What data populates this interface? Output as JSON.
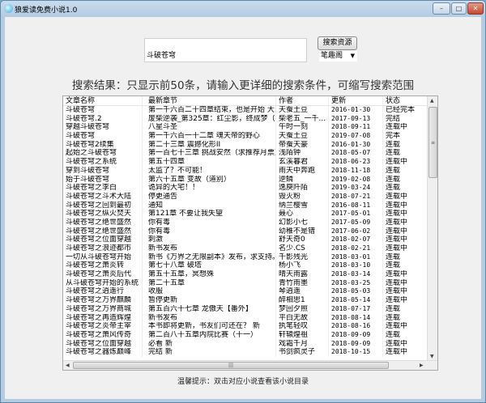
{
  "window": {
    "title": "狼爱读免费小说1.0",
    "minimize": "–",
    "maximize": "□",
    "close": "✕"
  },
  "search": {
    "value": "斗破苍穹",
    "button": "搜索资源",
    "source": "笔趣阁"
  },
  "heading": "搜索结果：只显示前50条，请输入更详细的搜索条件，可缩写搜索范围",
  "table": {
    "columns": [
      "文章名称",
      "最新章节",
      "作者",
      "更新",
      "状态"
    ],
    "rows": [
      [
        "斗破苍穹",
        "第一千六百二十四章结束，也是开始 大...",
        "天蚕土豆",
        "2016-01-30",
        "已经完本"
      ],
      [
        "斗破苍穹.2",
        "废柴逆袭_第325章：红尘影，终成梦（...",
        "柴老五_一千...",
        "2017-09-13",
        "完结"
      ],
      [
        "穿越斗破苍穹",
        "八星斗圣",
        "午时一刻",
        "2018-09-11",
        "连载中"
      ],
      [
        "斗破苍穹",
        "第一千六百一十二章 魂天帝的野心",
        "天蚕土豆",
        "2019-07-08",
        "完本"
      ],
      [
        "斗破苍穹2续集",
        "第二十三章 震撼化形II",
        "帝蚕天豪",
        "2016-01-30",
        "连载"
      ],
      [
        "起始之斗破苍穹",
        "第一百七十三章 挑战安然（求推荐月票）",
        "浅陌钟",
        "2018-05-07",
        "连载"
      ],
      [
        "斗破苍穹之系统",
        "第五十四章",
        "玄溪暮君",
        "2018-06-23",
        "连载中"
      ],
      [
        "穿到斗破苍穹",
        "太监了？不可能！",
        "雨天中奔跑",
        "2018-11-18",
        "连载"
      ],
      [
        "始于斗破苍穹",
        "第六十五章 变故（道别）",
        "逆鳞",
        "2019-02-08",
        "连载"
      ],
      [
        "斗破苍穹之李白",
        "诡异的大宅！！",
        "逸庾阡陌",
        "2019-03-24",
        "连载"
      ],
      [
        "斗破苍穹之斗术大陆",
        "停更通告",
        "毁灭粉",
        "2018-07-21",
        "连载中"
      ],
      [
        "斗破苍穹之回到最初",
        "通知",
        "纳兰樱雪",
        "2016-08-11",
        "连载中"
      ],
      [
        "斗破苍穹之纵火焚天",
        "第121章 不要让我失望",
        "聂心",
        "2017-05-01",
        "连载中"
      ],
      [
        "斗破苍穹之绝世盛然",
        "你有毒",
        "幻影小七",
        "2017-05-09",
        "连载中"
      ],
      [
        "斗破苍穹之绝世盛然",
        "你有毒",
        "幼稚不是错",
        "2017-06-02",
        "连载中"
      ],
      [
        "斗破苍穹之位面穿越",
        "刺激",
        "舒天奇0",
        "2018-02-07",
        "连载中"
      ],
      [
        "斗破苍穹之浪迹都市",
        "新书发布",
        "名少.CS",
        "2018-02-21",
        "连载中"
      ],
      [
        "一切从斗破苍穹开始",
        "新书《万界之无限副本》发布，求支持。",
        "千影残光",
        "2018-03-01",
        "连载"
      ],
      [
        "斗破苍穹之萧炎转",
        "第七十八章 破塔",
        "杨小飞",
        "2018-03-10",
        "连载"
      ],
      [
        "斗破苍穹之萧炎后代",
        "第五十五章，冥想殊",
        "晴天雨露",
        "2018-03-14",
        "连载中"
      ],
      [
        "从斗破苍穹开始的系统",
        "第二十五章",
        "青竹雨墨",
        "2018-03-25",
        "连载中"
      ],
      [
        "斗破苍穹之逍遥行",
        "收服",
        "琴逍遥",
        "2018-05-03",
        "连载中"
      ],
      [
        "斗破苍穹之万界麒麟",
        "暂停更新",
        "醉相思1",
        "2018-05-14",
        "连载中"
      ],
      [
        "斗破苍穹之万界商城",
        "第五百六十七章 龙傲天【番外】",
        "梦回夕照",
        "2018-07-17",
        "连载"
      ],
      [
        "斗破苍穹之再造辉煌",
        "新书发布",
        "平白无故",
        "2018-08-14",
        "连载"
      ],
      [
        "斗破苍穹之炎帝主宰",
        "本书即将更新，书友们可还在？ 新",
        "执笔轻叹",
        "2018-08-16",
        "连载中"
      ],
      [
        "斗破苍穹之萧风传奇",
        "第二百八十五章内院比赛（十一）",
        "轩辕煌祖",
        "2018-09-09",
        "连载"
      ],
      [
        "斗破苍穹之位面穿越",
        "必看 新",
        "戏霜千月",
        "2018-09-09",
        "连载中"
      ],
      [
        "斗破苍穹之器炼巅峰",
        "完结 新",
        "书剑疯灵子",
        "2018-10-15",
        "连载中"
      ]
    ]
  },
  "hint": "温馨提示：双击对应小说查看该小说目录"
}
